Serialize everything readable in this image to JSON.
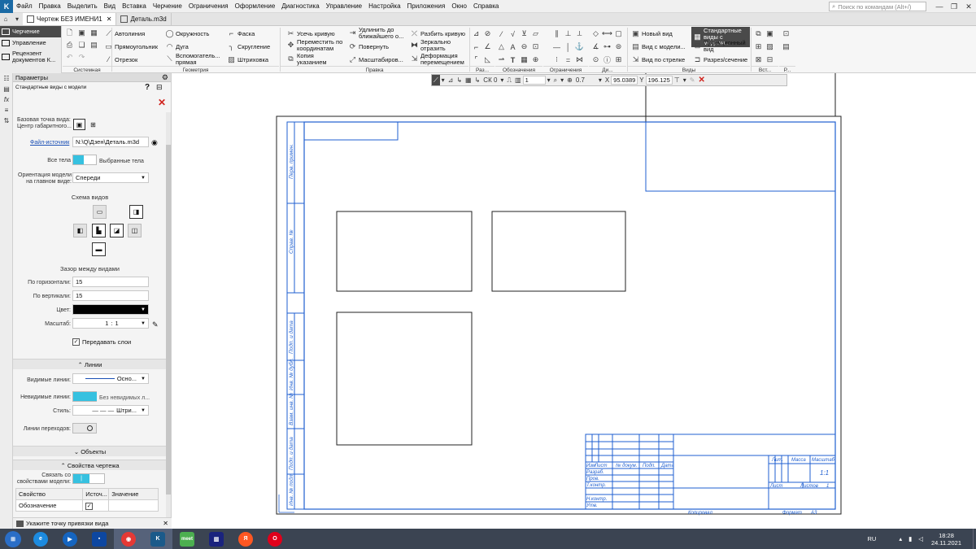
{
  "menu": {
    "items": [
      "Файл",
      "Правка",
      "Выделить",
      "Вид",
      "Вставка",
      "Черчение",
      "Ограничения",
      "Оформление",
      "Диагностика",
      "Управление",
      "Настройка",
      "Приложения",
      "Окно",
      "Справка"
    ],
    "search_placeholder": "Поиск по командам (Alt+/)"
  },
  "tabs": {
    "items": [
      {
        "label": "Чертеж БЕЗ ИМЕНИ1",
        "active": true
      },
      {
        "label": "Деталь.m3d",
        "active": false
      }
    ]
  },
  "modes": {
    "items": [
      "Черчение",
      "Управление",
      "Рецензент документов К..."
    ],
    "active": "Черчение"
  },
  "ribbon": {
    "system": {
      "label": "Системная"
    },
    "geometry": {
      "label": "Геометрия",
      "items": [
        "Автолиния",
        "Окружность",
        "Фаска",
        "Прямоугольник",
        "Дуга",
        "Скругление",
        "Отрезок",
        "Вспомогатель... прямая",
        "Штриховка"
      ]
    },
    "edit": {
      "label": "Правка",
      "items": [
        "Усечь кривую",
        "Удлинить до ближайшего о...",
        "Разбить кривую",
        "Переместить по координатам",
        "Повернуть",
        "Зеркально отразить",
        "Копия указанием",
        "Масштабиров...",
        "Деформация перемещением"
      ]
    },
    "small_groups": [
      "Раз...",
      "Обозначения",
      "Ограничения",
      "Ди...",
      "Вст...",
      "Р..."
    ],
    "views": {
      "label": "Виды",
      "items": [
        "Новый вид",
        "Стандартные виды с модели...",
        "Вид с модели...",
        "Проекционный вид",
        "Вид по стрелке",
        "Разрез/сечение"
      ]
    }
  },
  "params": {
    "header": "Параметры",
    "subtitle": "Стандартные виды с модели",
    "base_point_label": "Базовая точка вида: Центр габаритного...",
    "source_file_label": "Файл-источник",
    "source_file_value": "N:\\Q\\Дзен\\Деталь.m3d",
    "all_bodies_label": "Все тела",
    "selected_bodies_label": "Выбранные тела",
    "orientation_label": "Ориентация модели на главном виде:",
    "orientation_value": "Спереди",
    "scheme_title": "Схема видов",
    "gap_title": "Зазор между видами",
    "gap_h_label": "По горизонтали:",
    "gap_h_value": "15",
    "gap_v_label": "По вертикали:",
    "gap_v_value": "15",
    "color_label": "Цвет:",
    "color_value": "#000000",
    "scale_label": "Масштаб:",
    "scale_num": "1",
    "scale_sep": ":",
    "scale_den": "1",
    "pass_layers_label": "Передавать слои",
    "lines_section": "Линии",
    "visible_lines_label": "Видимые линии:",
    "visible_lines_value": "Осно...",
    "hidden_lines_label": "Невидимые линии:",
    "hidden_lines_value": "Без невидимых л...",
    "style_label": "Стиль:",
    "style_value": "Штри...",
    "transition_lines_label": "Линии переходов:",
    "objects_section": "Объекты",
    "drawing_props_section": "Свойства чертежа",
    "link_props_label": "Связать со свойствами модели:",
    "table_headers": [
      "Свойство",
      "Источ...",
      "Значение"
    ],
    "table_rows": [
      {
        "property": "Обозначение",
        "source_checked": true,
        "value": ""
      }
    ]
  },
  "status": {
    "text": "Укажите точку привязки вида"
  },
  "floating_toolbar": {
    "cs_label": "СК 0",
    "layer_value": "1",
    "zoom_value": "0.7",
    "x_label": "X",
    "x_value": "95.0389",
    "y_label": "Y",
    "y_value": "196.125"
  },
  "drawing": {
    "side_labels": [
      "Перв. примен.",
      "Справ. №",
      "Подп. и дата",
      "Инв. № дубл.",
      "Взам. инв. №",
      "Подп. и дата",
      "Инв. № подл."
    ],
    "title_block": {
      "col_headers": [
        "Изм",
        "Лист",
        "№ докум.",
        "Подп.",
        "Дата"
      ],
      "row_labels": [
        "Разраб.",
        "Пров.",
        "Т.контр.",
        "Н.контр.",
        "Утв."
      ],
      "lit_label": "Лит.",
      "mass_label": "Масса",
      "scale_label": "Масштаб",
      "scale_value": "1:1",
      "sheet_label": "Лист",
      "sheets_label": "Листов",
      "sheets_value": "1",
      "copied_label": "Копировал",
      "format_label": "Формат",
      "format_value": "A3"
    }
  },
  "taskbar": {
    "apps": [
      "start",
      "ie",
      "media",
      "save",
      "chrome",
      "kompas",
      "meet",
      "vscode",
      "yandex",
      "opera"
    ],
    "meet_label": "meet",
    "lang": "RU",
    "time": "18:28",
    "date": "24.11.2021"
  }
}
